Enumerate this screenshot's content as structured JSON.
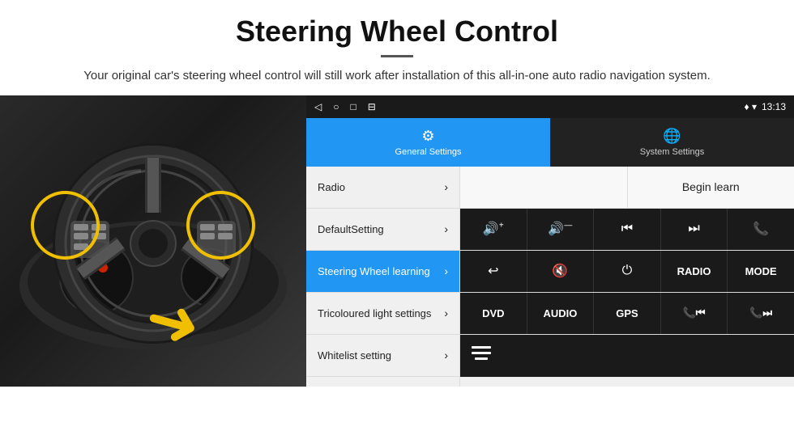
{
  "header": {
    "title": "Steering Wheel Control",
    "divider": true,
    "subtitle": "Your original car's steering wheel control will still work after installation of this all-in-one auto radio navigation system."
  },
  "status_bar": {
    "icons": [
      "◁",
      "○",
      "□",
      "⊟"
    ],
    "right_icons": "♦ ▾",
    "time": "13:13"
  },
  "tabs": [
    {
      "id": "general",
      "label": "General Settings",
      "active": true,
      "icon": "⚙"
    },
    {
      "id": "system",
      "label": "System Settings",
      "active": false,
      "icon": "🌐"
    }
  ],
  "menu": {
    "items": [
      {
        "label": "Radio",
        "active": false
      },
      {
        "label": "DefaultSetting",
        "active": false
      },
      {
        "label": "Steering Wheel learning",
        "active": true
      },
      {
        "label": "Tricoloured light settings",
        "active": false
      },
      {
        "label": "Whitelist setting",
        "active": false
      }
    ]
  },
  "panel": {
    "begin_learn_label": "Begin learn",
    "row2_icons": [
      "🔊+",
      "🔊—",
      "⏮",
      "⏭",
      "📞"
    ],
    "row3_icons": [
      "↩",
      "🔊✕",
      "⏻",
      "RADIO",
      "MODE"
    ],
    "row4_labels": [
      "DVD",
      "AUDIO",
      "GPS",
      "📞⏮",
      "📞⏭"
    ],
    "row5_icon": "≡"
  },
  "car_image": {
    "alt": "Steering wheel with highlighted control buttons"
  }
}
